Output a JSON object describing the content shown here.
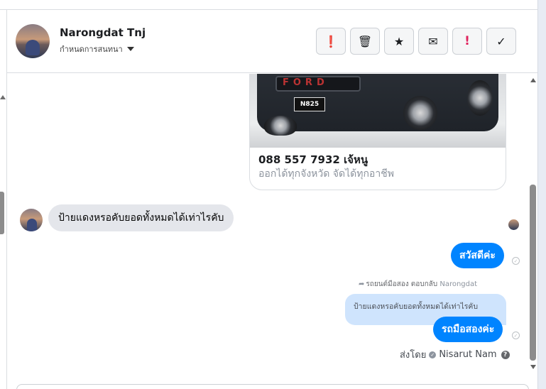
{
  "header": {
    "contact_name": "Narongdat Tnj",
    "label_selector": "กำหนดการสนทนา",
    "toolbar": [
      {
        "icon": "exclamation-circle-icon",
        "glyph": "❗"
      },
      {
        "icon": "trash-icon",
        "glyph": "🗑"
      },
      {
        "icon": "star-icon",
        "glyph": "★"
      },
      {
        "icon": "envelope-icon",
        "glyph": "✉"
      },
      {
        "icon": "exclamation-icon",
        "glyph": "!"
      },
      {
        "icon": "checkmark-icon",
        "glyph": "✓"
      }
    ]
  },
  "thread": {
    "shared_post": {
      "image_text": "FORD",
      "plate": "N825",
      "title": "088 557 7932 เจ้หนู",
      "subtitle": "ออกได้ทุกจังหวัด จัดได้ทุกอาชีพ"
    },
    "incoming_message": "ป้ายแดงหรอคับยอดทั้งหมดได้เท่าไรคับ",
    "outgoing_1": "สวัสดีค่ะ",
    "reply_meta": {
      "prefix": "รถยนต์มือสอง ตอบกลับ",
      "target": "Narongdat"
    },
    "quoted_message": "ป้ายแดงหรอคับยอดทั้งหมดได้เท่าไรคับ",
    "outgoing_2": "รถมือสองค่ะ",
    "sent_by": {
      "prefix": "ส่งโดย",
      "name": "Nisarut Nam"
    }
  },
  "colors": {
    "outgoing_bubble": "#0084ff",
    "incoming_bubble": "#e4e6eb",
    "quoted_bubble": "#cfe4fd",
    "flag_red": "#e0245e"
  }
}
